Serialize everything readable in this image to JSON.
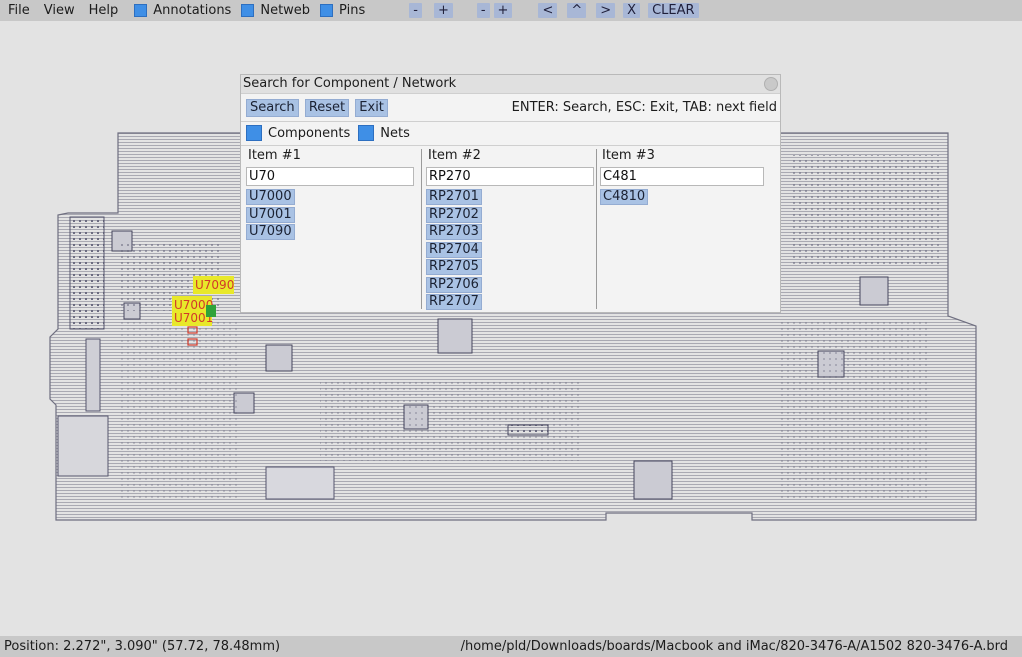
{
  "menu": {
    "file": "File",
    "view": "View",
    "help": "Help",
    "annotations": "Annotations",
    "netweb": "Netweb",
    "pins": "Pins",
    "zoom_out": "-",
    "zoom_in": "+",
    "rot_left": "-",
    "rot_right": "+",
    "prev": "<",
    "up": "^",
    "next": ">",
    "x": "X",
    "clear": "CLEAR"
  },
  "board_labels": {
    "u7090": "U7090",
    "u7000": "U7000",
    "u7001": "U7001"
  },
  "dialog": {
    "title": "Search for Component / Network",
    "search": "Search",
    "reset": "Reset",
    "exit": "Exit",
    "hint": "ENTER: Search, ESC: Exit, TAB: next field",
    "components": "Components",
    "nets": "Nets",
    "columns": [
      {
        "header": "Item #1",
        "value": "U70",
        "results": [
          "U7000",
          "U7001",
          "U7090"
        ]
      },
      {
        "header": "Item #2",
        "value": "RP270",
        "results": [
          "RP2701",
          "RP2702",
          "RP2703",
          "RP2704",
          "RP2705",
          "RP2706",
          "RP2707"
        ]
      },
      {
        "header": "Item #3",
        "value": "C481",
        "results": [
          "C4810"
        ]
      }
    ]
  },
  "status": {
    "position": "Position: 2.272\", 3.090\" (57.72, 78.48mm)",
    "path": "/home/pld/Downloads/boards/Macbook and iMac/820-3476-A/A1502 820-3476-A.brd"
  },
  "colors": {
    "accent": "#3f8fe6",
    "button": "#a9c2e4",
    "highlight_yellow": "#e8e82a",
    "highlight_text": "#d23a2a",
    "board_line": "#7d7d88"
  }
}
